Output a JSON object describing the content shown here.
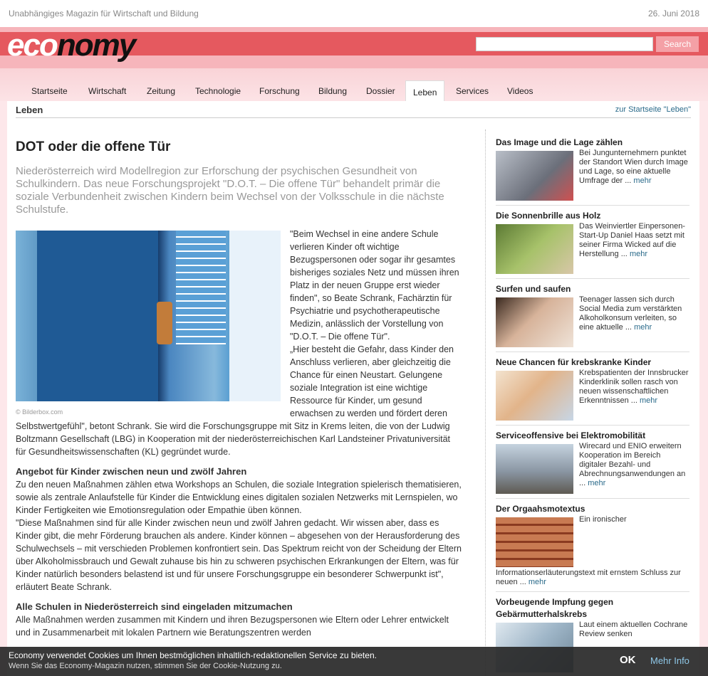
{
  "header": {
    "tagline": "Unabhängiges Magazin für Wirtschaft und Bildung",
    "date": "26. Juni 2018",
    "logo_part1": "eco",
    "logo_part2": "nomy",
    "search_placeholder": "",
    "search_label": "Search"
  },
  "nav": {
    "tabs": [
      "Startseite",
      "Wirtschaft",
      "Zeitung",
      "Technologie",
      "Forschung",
      "Bildung",
      "Dossier",
      "Leben",
      "Services",
      "Videos"
    ],
    "active": "Leben"
  },
  "section": {
    "title": "Leben",
    "link": "zur Startseite \"Leben\""
  },
  "article": {
    "title": "DOT oder die offene Tür",
    "lead": "Niederösterreich wird Modellregion zur Erforschung der psychischen Gesundheit von Schulkindern. Das neue Forschungsprojekt \"D.O.T. – Die offene Tür\" behandelt primär die soziale Verbundenheit zwischen Kindern beim Wechsel von der Volksschule in die nächste Schulstufe.",
    "image_caption": "© Bilderbox.com",
    "p1": "\"Beim Wechsel in eine andere Schule verlieren Kinder oft wichtige Bezugspersonen oder sogar ihr gesamtes bisheriges soziales Netz und müssen ihren Platz in der neuen Gruppe erst wieder finden\", so Beate Schrank, Fachärztin für Psychiatrie und psychotherapeutische Medizin, anlässlich der Vorstellung von \"D.O.T. – Die offene Tür\".",
    "p2": "„Hier besteht die Gefahr, dass Kinder den Anschluss verlieren, aber gleichzeitig die Chance für einen Neustart. Gelungene soziale Integration ist eine wichtige Ressource für Kinder, um gesund erwachsen zu werden und fördert deren Selbstwertgefühl\", betont Schrank. Sie wird die Forschungsgruppe mit Sitz in Krems leiten, die von der Ludwig Boltzmann Gesellschaft (LBG) in Kooperation mit der niederösterreichischen Karl Landsteiner Privatuniversität für Gesundheitswissenschaften (KL) gegründet wurde.",
    "h2a": "Angebot für Kinder zwischen neun und zwölf Jahren",
    "p3": "Zu den neuen Maßnahmen zählen etwa Workshops an Schulen, die soziale Integration spielerisch thematisieren, sowie als zentrale Anlaufstelle für Kinder die Entwicklung eines digitalen sozialen Netzwerks mit Lernspielen, wo Kinder Fertigkeiten wie Emotionsregulation oder Empathie üben können.",
    "p4": "\"Diese Maßnahmen sind für alle Kinder zwischen neun und zwölf Jahren gedacht. Wir wissen aber, dass es Kinder gibt, die mehr Förderung brauchen als andere. Kinder können – abgesehen von der Herausforderung des Schulwechsels – mit verschieden Problemen konfrontiert sein. Das Spektrum reicht von der Scheidung der Eltern über Alkoholmissbrauch und Gewalt zuhause bis hin zu schweren psychischen Erkrankungen der Eltern, was für Kinder natürlich besonders belastend ist und für unsere Forschungsgruppe ein besonderer Schwerpunkt ist\", erläutert Beate Schrank.",
    "h2b": "Alle Schulen in Niederösterreich sind eingeladen mitzumachen",
    "p5": "Alle Maßnahmen werden zusammen mit Kindern und ihren Bezugspersonen wie Eltern oder Lehrer entwickelt und in Zusammenarbeit mit lokalen Partnern wie Beratungszentren werden"
  },
  "sidebar": {
    "more_label": "mehr",
    "items": [
      {
        "title": "Das Image und die Lage zählen",
        "text": "Bei Jungunternehmern punktet der Standort Wien durch Image und Lage, so eine aktuelle Umfrage der ...",
        "thumb": "#8a8f9a"
      },
      {
        "title": "Die Sonnenbrille aus Holz",
        "text": "Das Weinviertler Einpersonen-Start-Up Daniel Haas setzt mit seiner Firma Wicked auf die Herstellung ...",
        "thumb": "#7fa04a"
      },
      {
        "title": "Surfen und saufen",
        "text": "Teenager lassen sich durch Social Media zum verstärkten Alkoholkonsum verleiten, so eine aktuelle ...",
        "thumb": "#c9b19c"
      },
      {
        "title": "Neue Chancen für krebskranke Kinder",
        "text": "Krebspatienten der Innsbrucker Kinderklinik sollen rasch von neuen wissenschaftlichen Erkenntnissen ...",
        "thumb": "#e9cfb0"
      },
      {
        "title": "Serviceoffensive bei Elektromobilität",
        "text": "Wirecard und ENIO erweitern Kooperation im Bereich digitaler Bezahl- und Abrechnungsanwendungen an ...",
        "thumb": "#8e9aa8"
      },
      {
        "title": "Der Orgaahsmotextus",
        "text": "Ein ironischer",
        "text2": "Informationserläuterungstext mit ernstem Schluss zur neuen ...",
        "thumb": "#b0553a"
      },
      {
        "title": "Vorbeugende Impfung gegen Gebärmutterhalskrebs",
        "text": "Laut einem aktuellen Cochrane Review senken",
        "thumb": "#9fb6c8"
      }
    ]
  },
  "cookie": {
    "line1": "Economy verwendet Cookies um Ihnen bestmöglichen inhaltlich-redaktionellen Service zu bieten.",
    "line2": "Wenn Sie das Economy-Magazin nutzen, stimmen Sie der Cookie-Nutzung zu.",
    "ok": "OK",
    "info": "Mehr Info"
  }
}
